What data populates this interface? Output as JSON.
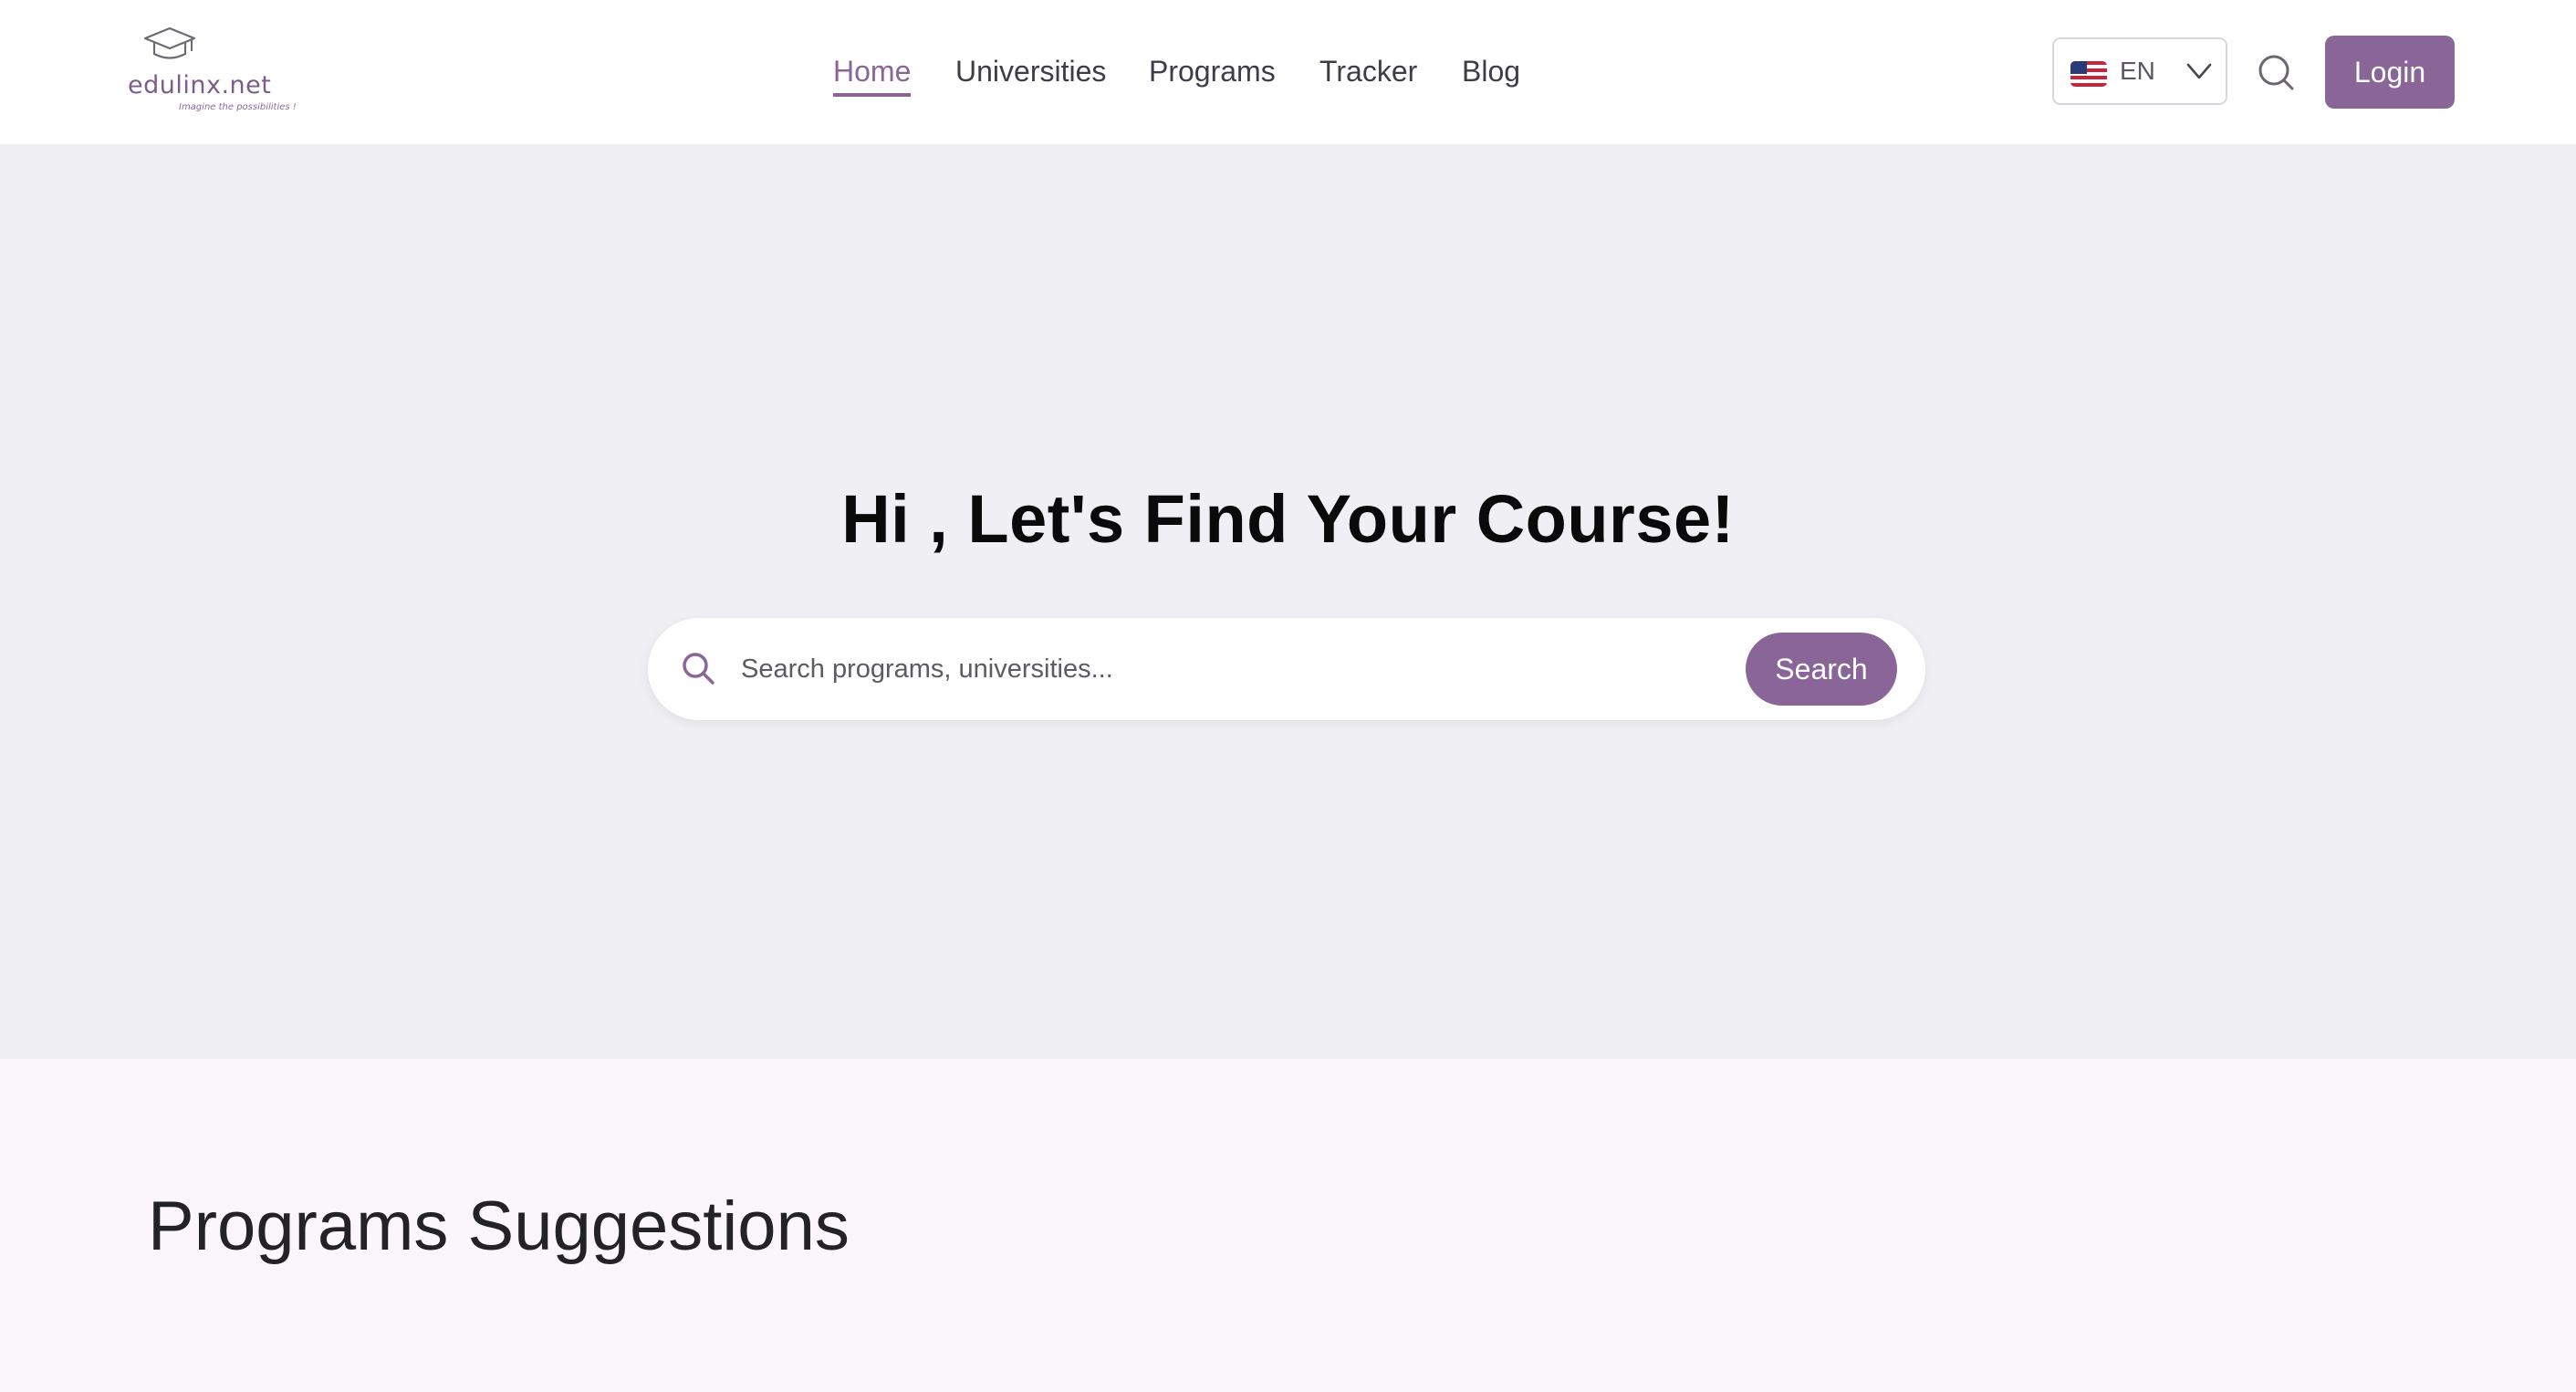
{
  "brand": {
    "name": "edulinx.net",
    "tagline": "Imagine the possibilities !",
    "accent_color": "#8a6598"
  },
  "nav": {
    "items": [
      {
        "label": "Home",
        "active": true
      },
      {
        "label": "Universities",
        "active": false
      },
      {
        "label": "Programs",
        "active": false
      },
      {
        "label": "Tracker",
        "active": false
      },
      {
        "label": "Blog",
        "active": false
      }
    ]
  },
  "language": {
    "code": "EN",
    "flag_icon": "us-flag-icon"
  },
  "header": {
    "search_icon": "search-icon",
    "login_label": "Login"
  },
  "hero": {
    "title": "Hi , Let's Find Your Course!",
    "search_placeholder": "Search programs, universities...",
    "search_value": "",
    "search_button": "Search",
    "background": "#f0eff3"
  },
  "programs": {
    "title": "Programs Suggestions"
  }
}
